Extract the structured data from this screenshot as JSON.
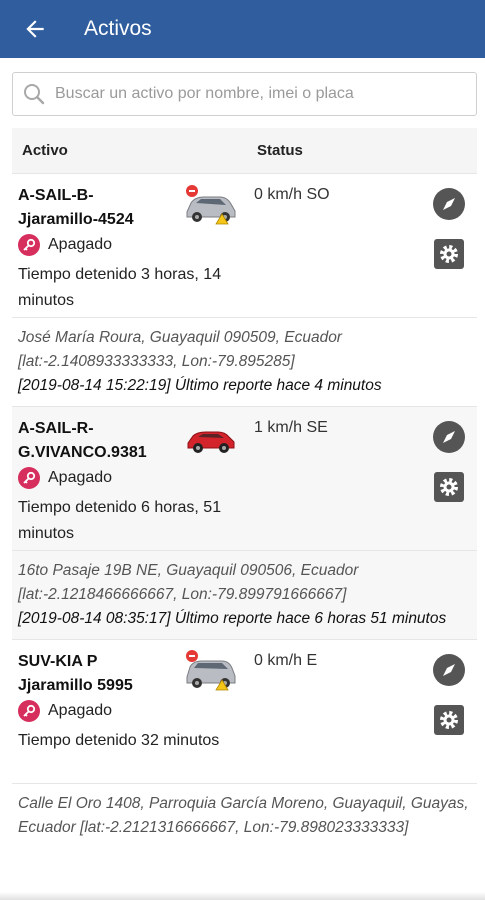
{
  "appbar": {
    "title": "Activos",
    "back_icon": "arrow-left-icon"
  },
  "search": {
    "placeholder": "Buscar un activo por nombre, imei o placa"
  },
  "table": {
    "headers": {
      "activo": "Activo",
      "status": "Status"
    },
    "assets": [
      {
        "name": "A-SAIL-B-Jjaramillo-4524",
        "name_line1": "A-SAIL-B-",
        "name_line2": "Jjaramillo-4524",
        "state": "Apagado",
        "stopped": "Tiempo detenido 3 horas, 14 minutos",
        "speed": "0 km/h SO",
        "car_color": "#b9bcc2",
        "car_badge": true,
        "address": "José María Roura, Guayaquil 090509, Ecuador [lat:-2.1408933333333, Lon:-79.895285]",
        "report": "[2019-08-14 15:22:19] Último reporte hace 4 minutos"
      },
      {
        "name": "A-SAIL-R-G.VIVANCO.9381",
        "name_line1": "A-SAIL-R-",
        "name_line2": "G.VIVANCO.9381",
        "state": "Apagado",
        "stopped": "Tiempo detenido 6 horas, 51 minutos",
        "speed": "1 km/h SE",
        "car_color": "#d3242c",
        "car_badge": false,
        "address": "16to Pasaje 19B NE, Guayaquil 090506, Ecuador [lat:-2.1218466666667, Lon:-79.899791666667]",
        "report": "[2019-08-14 08:35:17] Último reporte hace 6 horas 51 minutos"
      },
      {
        "name": "SUV-KIA P Jjaramillo 5995",
        "name_line1": "SUV-KIA P",
        "name_line2": "Jjaramillo 5995",
        "state": "Apagado",
        "stopped": "Tiempo detenido 32 minutos",
        "speed": "0 km/h E",
        "car_color": "#b9bcc2",
        "car_badge": true,
        "address": "Calle El Oro 1408, Parroquia García Moreno, Guayaquil, Guayas, Ecuador [lat:-2.2121316666667, Lon:-79.898023333333]",
        "report": ""
      }
    ]
  },
  "colors": {
    "appbar": "#2f5d9e",
    "key_badge": "#d62f5e",
    "action_icon": "#555555"
  }
}
